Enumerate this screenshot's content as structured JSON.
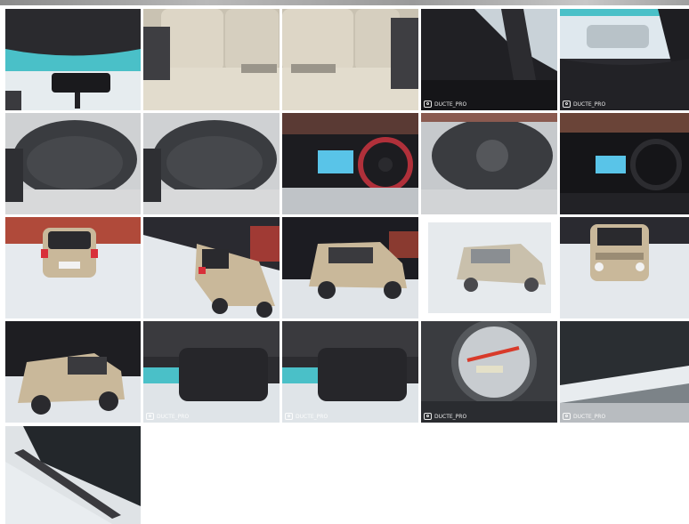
{
  "gallery": {
    "photos": [
      {
        "subject": "interior-rear-view-mirror"
      },
      {
        "subject": "interior-rear-seats"
      },
      {
        "subject": "interior-rear-seats"
      },
      {
        "subject": "interior-a-pillar-night"
      },
      {
        "subject": "interior-dashboard-snow"
      },
      {
        "subject": "instrument-cluster"
      },
      {
        "subject": "instrument-cluster"
      },
      {
        "subject": "dashboard-steering-wheel"
      },
      {
        "subject": "instrument-cluster"
      },
      {
        "subject": "dashboard-night"
      },
      {
        "subject": "exterior-rear-night"
      },
      {
        "subject": "exterior-rear-angle"
      },
      {
        "subject": "exterior-side-night"
      },
      {
        "subject": "exterior-front-angle-snow"
      },
      {
        "subject": "exterior-front-night"
      },
      {
        "subject": "exterior-side-front"
      },
      {
        "subject": "interior-headliner-mirror"
      },
      {
        "subject": "interior-headliner-mirror"
      },
      {
        "subject": "odometer-gauge"
      },
      {
        "subject": "windshield-wiper-snow"
      },
      {
        "subject": "windshield-wiper-snow"
      }
    ],
    "watermark_text": "DUCTE_PRO"
  },
  "colors": {
    "snow": "#e8ecef",
    "car_beige": "#c9b89a",
    "night": "#1c1c20",
    "interior_beige": "#d8d0c0",
    "wall_red": "#b04a3a"
  }
}
